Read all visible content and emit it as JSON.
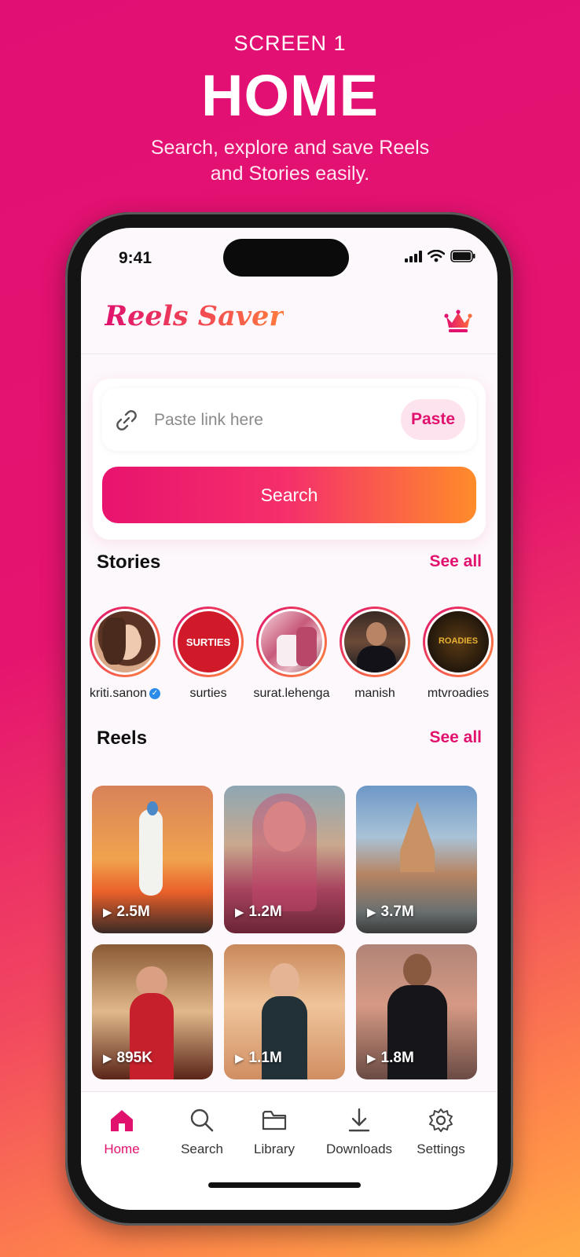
{
  "header": {
    "eyebrow": "SCREEN 1",
    "title": "HOME",
    "subtitle_line1": "Search, explore and save Reels",
    "subtitle_line2": "and Stories easily."
  },
  "status_bar": {
    "time": "9:41"
  },
  "app": {
    "name": "Reels Saver",
    "premium_icon": "crown-icon"
  },
  "search": {
    "placeholder": "Paste link here",
    "value": "",
    "paste_label": "Paste",
    "search_label": "Search"
  },
  "stories": {
    "title": "Stories",
    "see_all": "See all",
    "items": [
      {
        "name": "kriti.sanon",
        "verified": true
      },
      {
        "name": "surties",
        "verified": false,
        "logo_text": "SURTIES"
      },
      {
        "name": "surat.lehenga",
        "verified": false
      },
      {
        "name": "manish",
        "verified": false
      },
      {
        "name": "mtvroadies",
        "verified": false,
        "logo_text": "ROADIES"
      }
    ]
  },
  "reels": {
    "title": "Reels",
    "see_all": "See all",
    "items": [
      {
        "views": "2.5M"
      },
      {
        "views": "1.2M"
      },
      {
        "views": "3.7M"
      },
      {
        "views": "895K"
      },
      {
        "views": "1.1M"
      },
      {
        "views": "1.8M"
      }
    ]
  },
  "tabs": [
    {
      "label": "Home",
      "icon": "home-icon",
      "active": true
    },
    {
      "label": "Search",
      "icon": "search-icon",
      "active": false
    },
    {
      "label": "Library",
      "icon": "folder-icon",
      "active": false
    },
    {
      "label": "Downloads",
      "icon": "download-icon",
      "active": false
    },
    {
      "label": "Settings",
      "icon": "gear-icon",
      "active": false
    }
  ],
  "colors": {
    "brand": "#e0126e",
    "accent": "#ff8a3c",
    "verified": "#2a8ce8"
  }
}
